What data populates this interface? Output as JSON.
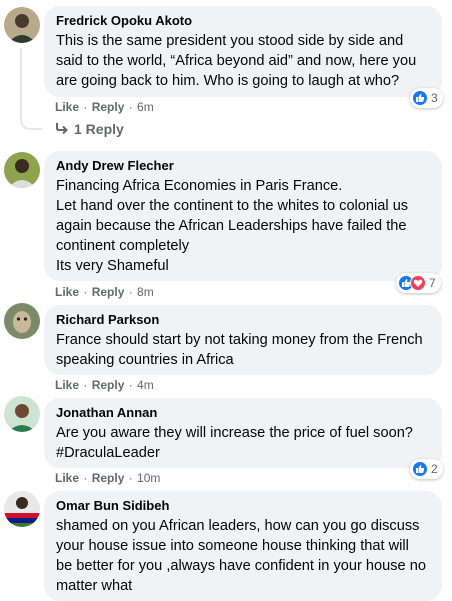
{
  "comments": [
    {
      "author": "Fredrick Opoku Akoto",
      "lines": [
        "This is the same president you stood side by side and",
        "said to the world, “Africa beyond aid” and now, here you",
        "are going back to him. Who is going to laugh at who?"
      ],
      "like": "Like",
      "reply": "Reply",
      "time": "6m",
      "reaction_count": "3",
      "reactions": [
        "like-icon"
      ]
    },
    {
      "author": "Andy Drew Flecher",
      "lines": [
        "Financing Africa Economies in Paris France.",
        "Let hand over the continent to the whites to colonial us",
        "again because the African Leaderships have failed the",
        "continent completely",
        "Its very Shameful"
      ],
      "like": "Like",
      "reply": "Reply",
      "time": "8m",
      "reaction_count": "7",
      "reactions": [
        "like-icon",
        "love-icon"
      ]
    },
    {
      "author": "Richard Parkson",
      "lines": [
        "France should start by not taking money from the French",
        "speaking countries in Africa"
      ],
      "like": "Like",
      "reply": "Reply",
      "time": "4m"
    },
    {
      "author": "Jonathan Annan",
      "lines": [
        "Are you aware they will increase the price of fuel soon?",
        "#DraculaLeader"
      ],
      "like": "Like",
      "reply": "Reply",
      "time": "10m",
      "reaction_count": "2",
      "reactions": [
        "like-icon"
      ]
    },
    {
      "author": "Omar Bun Sidibeh",
      "lines": [
        "shamed on you African leaders, how can you go discuss",
        "your house issue into someone house thinking that will",
        "be better for you ,always have confident in your house no",
        "matter what"
      ]
    }
  ],
  "replies_link": "1 Reply",
  "colors": {
    "bubble": "#f0f2f5",
    "meta": "#65676b",
    "like_blue": "#1877f2",
    "love_red": "#f33e58"
  }
}
